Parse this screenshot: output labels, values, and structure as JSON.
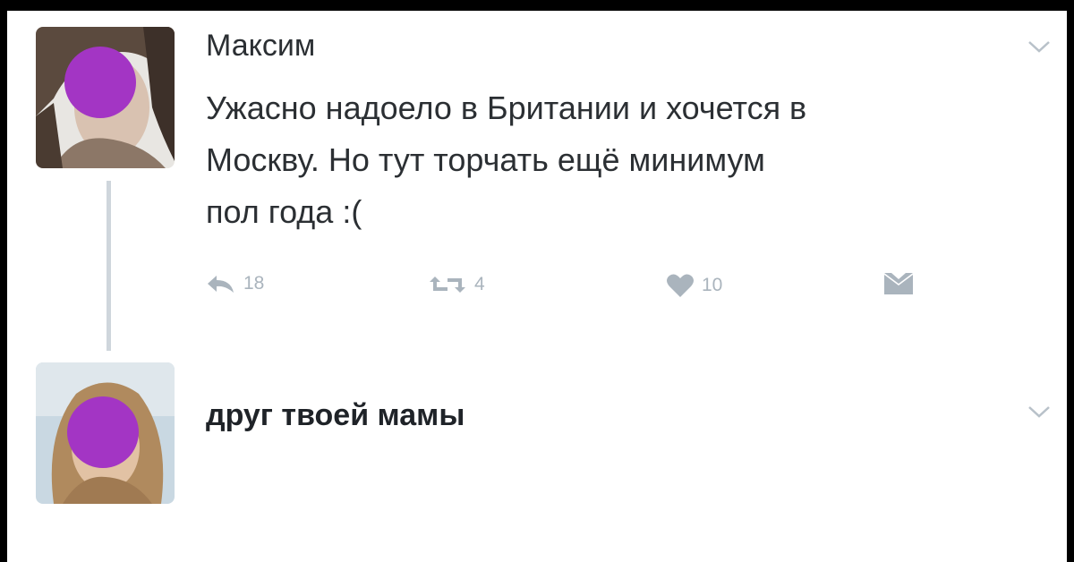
{
  "tweet": {
    "author": "Максим",
    "text_lines": [
      "Ужасно надоело в Британии и хочется в",
      "Москву. Но тут торчать ещё минимум",
      "пол года :("
    ],
    "reply_count": "18",
    "retweet_count": "4",
    "like_count": "10"
  },
  "reply": {
    "author": "друг твоей мамы"
  },
  "colors": {
    "background": "#000000",
    "card": "#ffffff",
    "text": "#2b2f33",
    "icon_gray": "#aab4bd",
    "blur_circle": "#a335c4"
  },
  "icons": {
    "reply": "reply-icon",
    "retweet": "retweet-icon",
    "like": "heart-icon",
    "dm": "envelope-icon",
    "more": "chevron-down-icon"
  }
}
